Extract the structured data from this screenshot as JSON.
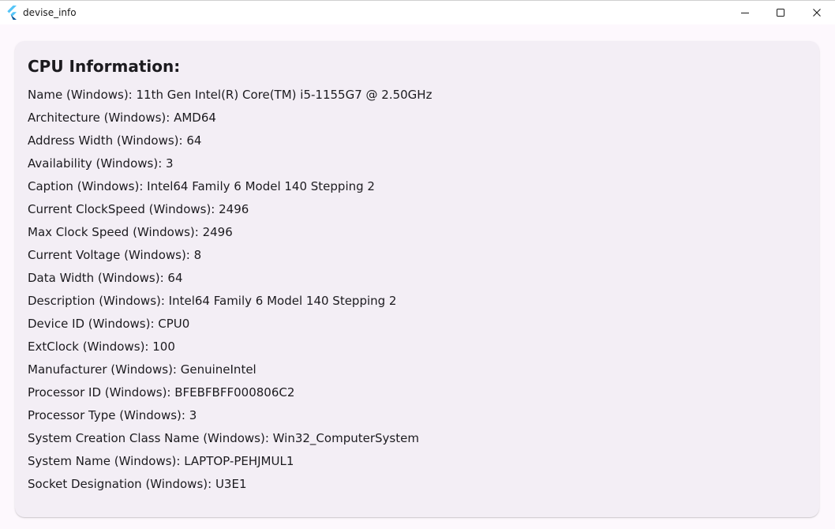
{
  "window": {
    "title": "devise_info",
    "controls": {
      "minimize_icon": "minimize-icon",
      "maximize_icon": "maximize-icon",
      "close_icon": "close-icon"
    }
  },
  "card": {
    "title": "CPU Information:",
    "items": [
      "Name (Windows): 11th Gen Intel(R) Core(TM) i5-1155G7 @ 2.50GHz",
      "Architecture (Windows): AMD64",
      "Address Width (Windows): 64",
      "Availability (Windows): 3",
      "Caption (Windows): Intel64 Family 6 Model 140 Stepping 2",
      "Current ClockSpeed (Windows): 2496",
      "Max Clock Speed (Windows): 2496",
      "Current Voltage (Windows): 8",
      "Data Width (Windows): 64",
      "Description (Windows): Intel64 Family 6 Model 140 Stepping 2",
      "Device ID (Windows): CPU0",
      "ExtClock (Windows): 100",
      "Manufacturer (Windows): GenuineIntel",
      "Processor ID (Windows): BFEBFBFF000806C2",
      "Processor Type (Windows): 3",
      "System Creation Class Name (Windows): Win32_ComputerSystem",
      "System Name (Windows): LAPTOP-PEHJMUL1",
      "Socket Designation (Windows): U3E1"
    ]
  },
  "colors": {
    "flutter_light": "#54C5F8",
    "flutter_dark": "#01579B",
    "card_background": "#F3EEF5",
    "page_background": "#FDF8FD"
  }
}
